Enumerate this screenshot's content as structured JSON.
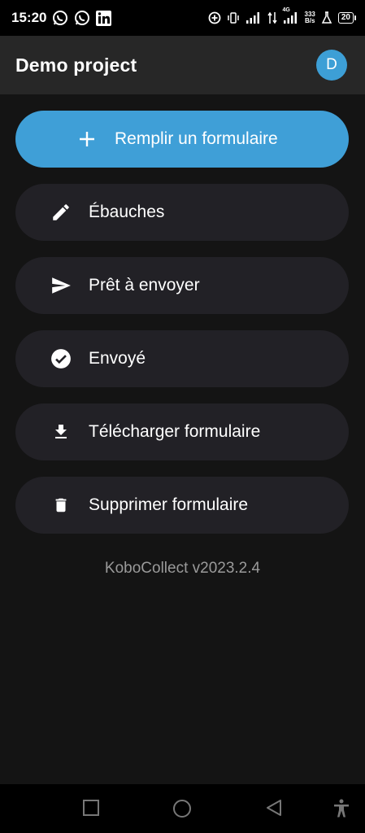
{
  "status_bar": {
    "time": "15:20",
    "speed_top": "333",
    "speed_bottom": "B/s",
    "network": "4G",
    "battery": "20"
  },
  "app_bar": {
    "title": "Demo project",
    "avatar_letter": "D"
  },
  "menu": {
    "fill_form": "Remplir un formulaire",
    "drafts": "Ébauches",
    "ready": "Prêt à envoyer",
    "sent": "Envoyé",
    "download": "Télécharger formulaire",
    "delete": "Supprimer formulaire"
  },
  "version": "KoboCollect v2023.2.4",
  "colors": {
    "primary": "#3f9fd7",
    "background": "#141414",
    "card": "#222126",
    "app_bar": "#272727"
  }
}
